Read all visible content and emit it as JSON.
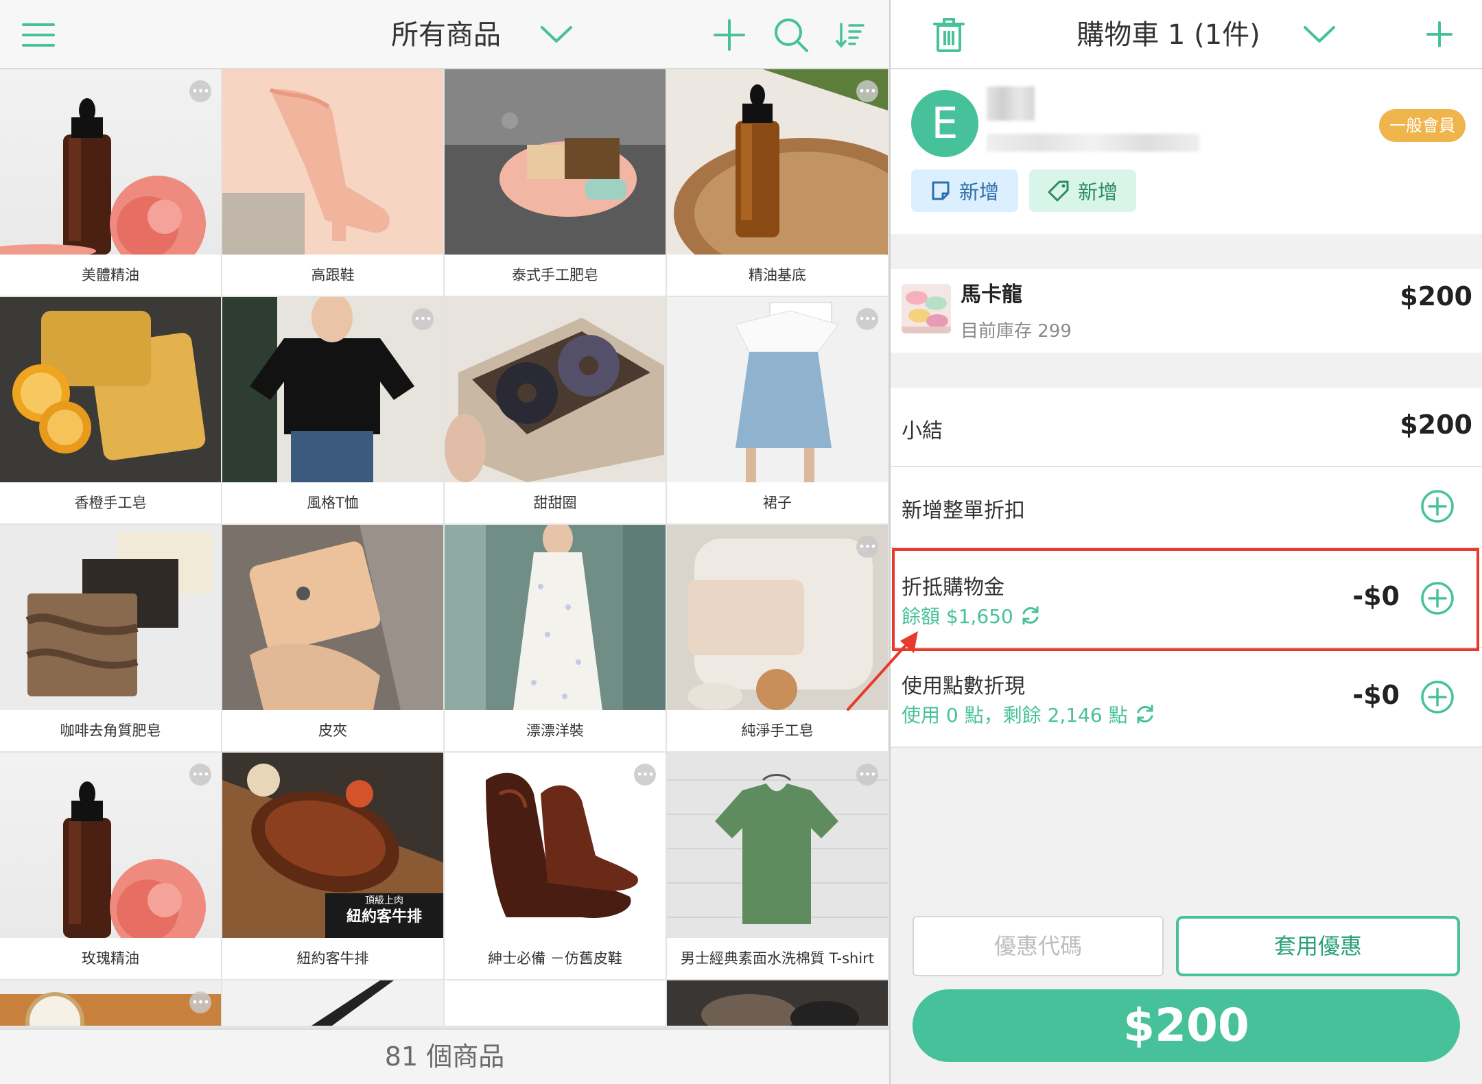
{
  "left_panel": {
    "title": "所有商品",
    "product_count": "81 個商品",
    "products": [
      {
        "name": "美體精油",
        "icon": "essential-oil"
      },
      {
        "name": "高跟鞋",
        "icon": "high-heel"
      },
      {
        "name": "泰式手工肥皂",
        "icon": "soap-dish"
      },
      {
        "name": "精油基底",
        "icon": "essential-oil"
      },
      {
        "name": "香橙手工皂",
        "icon": "orange-soap"
      },
      {
        "name": "風格T恤",
        "icon": "t-shirt"
      },
      {
        "name": "甜甜圈",
        "icon": "donut"
      },
      {
        "name": "裙子",
        "icon": "skirt"
      },
      {
        "name": "咖啡去角質肥皂",
        "icon": "soap"
      },
      {
        "name": "皮夾",
        "icon": "wallet"
      },
      {
        "name": "漂漂洋裝",
        "icon": "dress"
      },
      {
        "name": "純淨手工皂",
        "icon": "soap"
      },
      {
        "name": "玫瑰精油",
        "icon": "essential-oil"
      },
      {
        "name": "紐約客牛排",
        "icon": "steak",
        "overlay_line1": "頂級上肉",
        "overlay_line2": "紐約客牛排"
      },
      {
        "name": "紳士必備 －仿舊皮鞋",
        "icon": "leather-shoe"
      },
      {
        "name": "男士經典素面水洗棉質 T-shirt",
        "icon": "t-shirt"
      },
      {
        "name": "",
        "icon": "watch"
      },
      {
        "name": "",
        "icon": "belt"
      },
      {
        "name": "",
        "icon": "blank"
      },
      {
        "name": "",
        "icon": "photo"
      }
    ],
    "more_glyph": "•••"
  },
  "right_panel": {
    "cart_title": "購物車 1 (1件)",
    "customer": {
      "avatar_letter": "E",
      "member_level": "一般會員",
      "note_button": "新增",
      "tag_button": "新增"
    },
    "cart_item": {
      "name": "馬卡龍",
      "stock": "目前庫存 299",
      "price": "$200"
    },
    "summary": {
      "subtotal_label": "小結",
      "subtotal_value": "$200",
      "order_discount_label": "新增整單折扣",
      "store_credit_label": "折抵購物金",
      "store_credit_balance": "餘額 $1,650",
      "store_credit_value": "-$0",
      "points_label": "使用點數折現",
      "points_info": "使用 0 點，剩餘 2,146 點",
      "points_value": "-$0"
    },
    "coupon_placeholder": "優惠代碼",
    "apply_coupon": "套用優惠",
    "total": "$200"
  },
  "colors": {
    "accent": "#46c19a",
    "badge": "#f0b44c",
    "highlight": "#e8392a"
  }
}
